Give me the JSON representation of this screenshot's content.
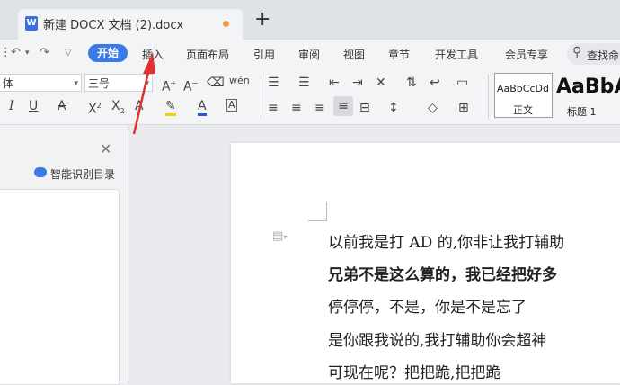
{
  "tab": {
    "title": "新建 DOCX 文档 (2).docx",
    "icon_letter": "W"
  },
  "new_tab": "+",
  "quick_access": {
    "redo": "↷",
    "more": "▽"
  },
  "menu": {
    "start": "开始",
    "insert": "插入",
    "layout": "页面布局",
    "references": "引用",
    "review": "审阅",
    "view": "视图",
    "section": "章节",
    "developer": "开发工具",
    "member": "会员专享",
    "search": "查找命"
  },
  "font": {
    "name": "体",
    "size": "三号"
  },
  "styles": {
    "normal_preview": "AaBbCcDd",
    "normal_label": "正文",
    "heading_preview": "AaBbA",
    "heading_label": "标题 1"
  },
  "left_pane": {
    "smart_toc": "智能识别目录"
  },
  "document": {
    "lines": [
      {
        "text": "以前我是打 AD 的,你非让我打辅助",
        "bold": false
      },
      {
        "text": "兄弟不是这么算的，我已经把好多",
        "bold": true
      },
      {
        "text": "停停停，不是，你是不是忘了",
        "bold": false
      },
      {
        "text": "是你跟我说的,我打辅助你会超神",
        "bold": false
      },
      {
        "text": "可现在呢？把把跪,把把跪",
        "bold": false
      }
    ]
  },
  "colors": {
    "accent": "#3a7ae8",
    "arrow": "#e03030",
    "font_color_bar": "#2255dd",
    "highlight": "#f5d000"
  }
}
